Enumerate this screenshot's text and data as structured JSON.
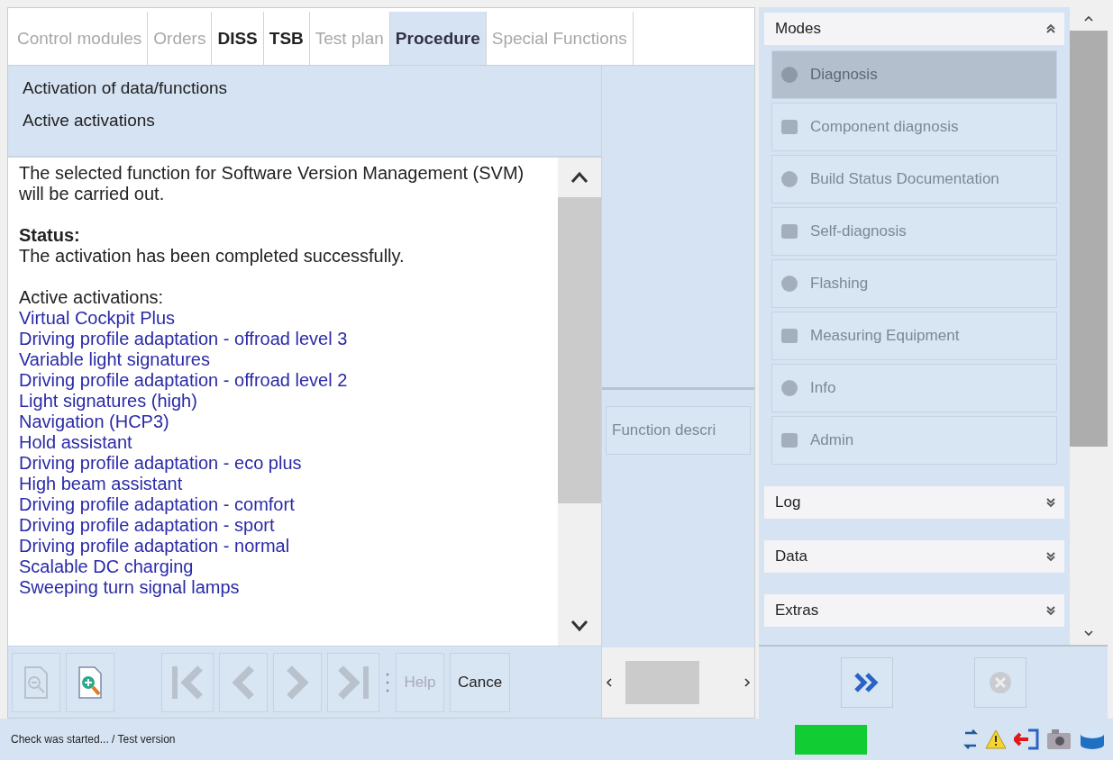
{
  "tabs": [
    {
      "label": "Control modules",
      "selected": false,
      "disabled": true
    },
    {
      "label": "Orders",
      "selected": false,
      "disabled": true
    },
    {
      "label": "DISS",
      "selected": false,
      "disabled": false
    },
    {
      "label": "TSB",
      "selected": false,
      "disabled": false
    },
    {
      "label": "Test plan",
      "selected": false,
      "disabled": true
    },
    {
      "label": "Procedure",
      "selected": true,
      "disabled": false
    },
    {
      "label": "Special Functions",
      "selected": false,
      "disabled": true
    }
  ],
  "header": {
    "title": "Activation of data/functions",
    "subtitle": "Active activations"
  },
  "content": {
    "intro": "The selected function for Software Version Management (SVM) will be carried out.",
    "status_label": "Status:",
    "status_text": "The activation has been completed successfully.",
    "list_label": "Active activations:",
    "activations": [
      "Virtual Cockpit Plus",
      "Driving profile adaptation - offroad level 3",
      "Variable light signatures",
      "Driving profile adaptation - offroad level 2",
      "Light signatures (high)",
      "Navigation (HCP3)",
      "Hold assistant",
      "Driving profile adaptation - eco plus",
      "High beam assistant",
      "Driving profile adaptation - comfort",
      "Driving profile adaptation - sport",
      "Driving profile adaptation - normal",
      "Scalable DC charging",
      "Sweeping turn signal lamps"
    ]
  },
  "toolbar": [
    {
      "kind": "zoom-out",
      "disabled": true
    },
    {
      "kind": "zoom-in",
      "disabled": false
    },
    {
      "kind": "first",
      "disabled": true
    },
    {
      "kind": "previous",
      "disabled": true
    },
    {
      "kind": "next",
      "disabled": true
    },
    {
      "kind": "last",
      "disabled": true
    },
    {
      "kind": "text",
      "label": "Help",
      "disabled": true
    },
    {
      "kind": "text",
      "label": "Cance",
      "disabled": false
    }
  ],
  "middle": {
    "function_button": "Function descri"
  },
  "modes": {
    "title": "Modes",
    "expanded": true,
    "items": [
      {
        "label": "Diagnosis",
        "selected": true,
        "disabled": true
      },
      {
        "label": "Component diagnosis",
        "selected": false,
        "disabled": true
      },
      {
        "label": "Build Status Documentation",
        "selected": false,
        "disabled": true
      },
      {
        "label": "Self-diagnosis",
        "selected": false,
        "disabled": true
      },
      {
        "label": "Flashing",
        "selected": false,
        "disabled": true
      },
      {
        "label": "Measuring Equipment",
        "selected": false,
        "disabled": true
      },
      {
        "label": "Info",
        "selected": false,
        "disabled": true
      },
      {
        "label": "Admin",
        "selected": false,
        "disabled": true
      }
    ]
  },
  "sections": [
    {
      "title": "Log",
      "expanded": false
    },
    {
      "title": "Data",
      "expanded": false
    },
    {
      "title": "Extras",
      "expanded": false
    }
  ],
  "actions": [
    {
      "kind": "forward",
      "disabled": false
    },
    {
      "kind": "cancel",
      "disabled": true
    }
  ],
  "status_bar": {
    "text": "Check was started... / Test version",
    "indicator_on": true
  }
}
